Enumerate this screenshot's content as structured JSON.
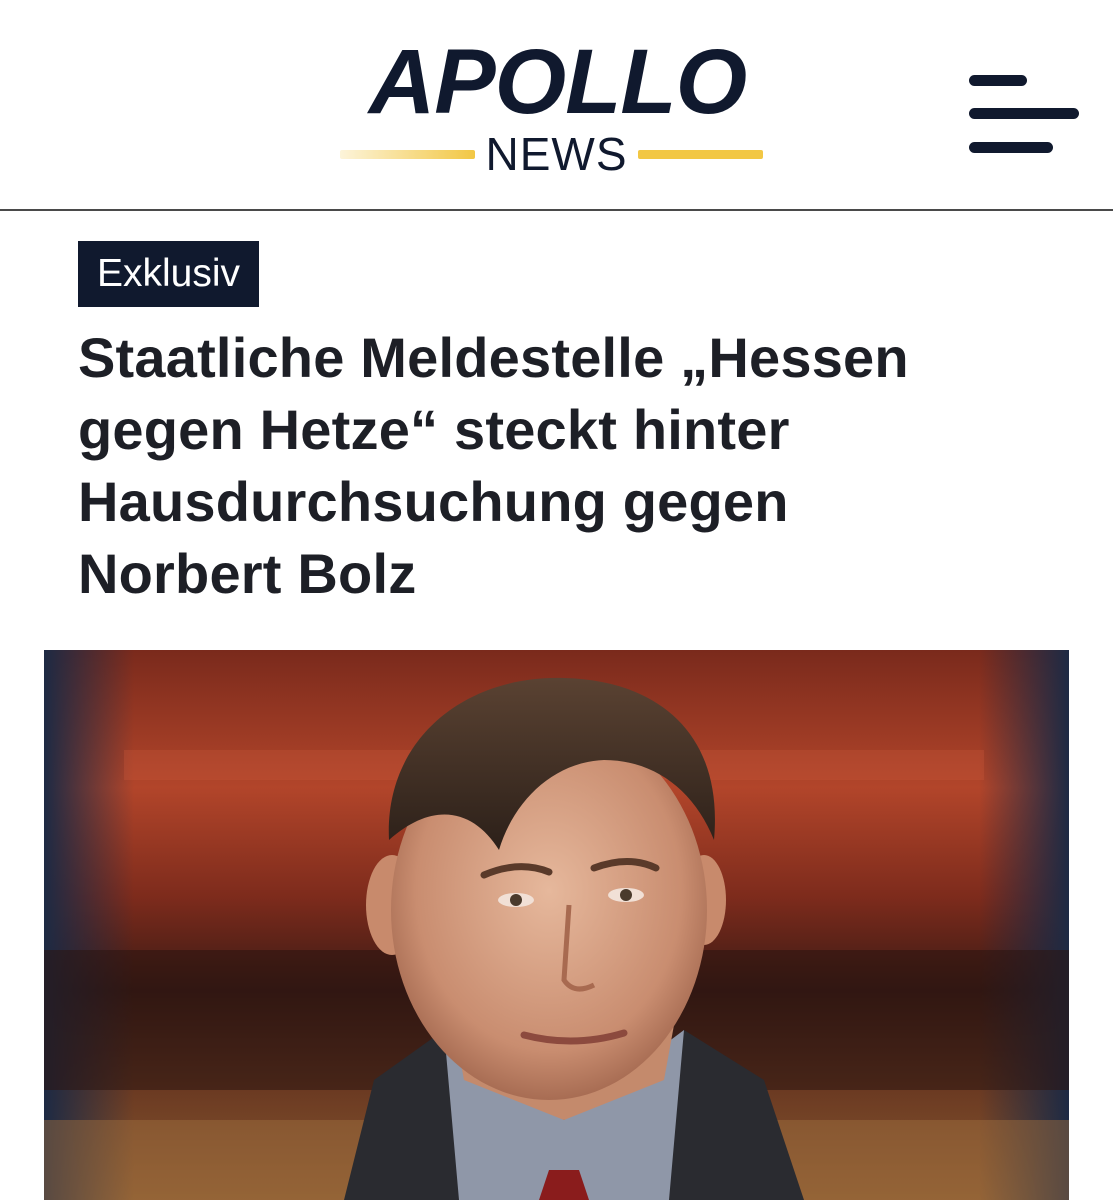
{
  "header": {
    "logo": {
      "wordmark": "APOLLO",
      "subtitle": "NEWS",
      "accent_color": "#f2c744",
      "text_color": "#10192e"
    },
    "menu_icon": "hamburger-menu-icon"
  },
  "article": {
    "category_badge": "Exklusiv",
    "headline_lines": [
      "Staatliche Meldestelle „Hessen",
      "gegen Hetze“ steckt hinter",
      "Hausdurchsuchung gegen",
      "Norbert Bolz"
    ],
    "badge_color": "#10192e",
    "hero_image": "portrait-photo"
  }
}
